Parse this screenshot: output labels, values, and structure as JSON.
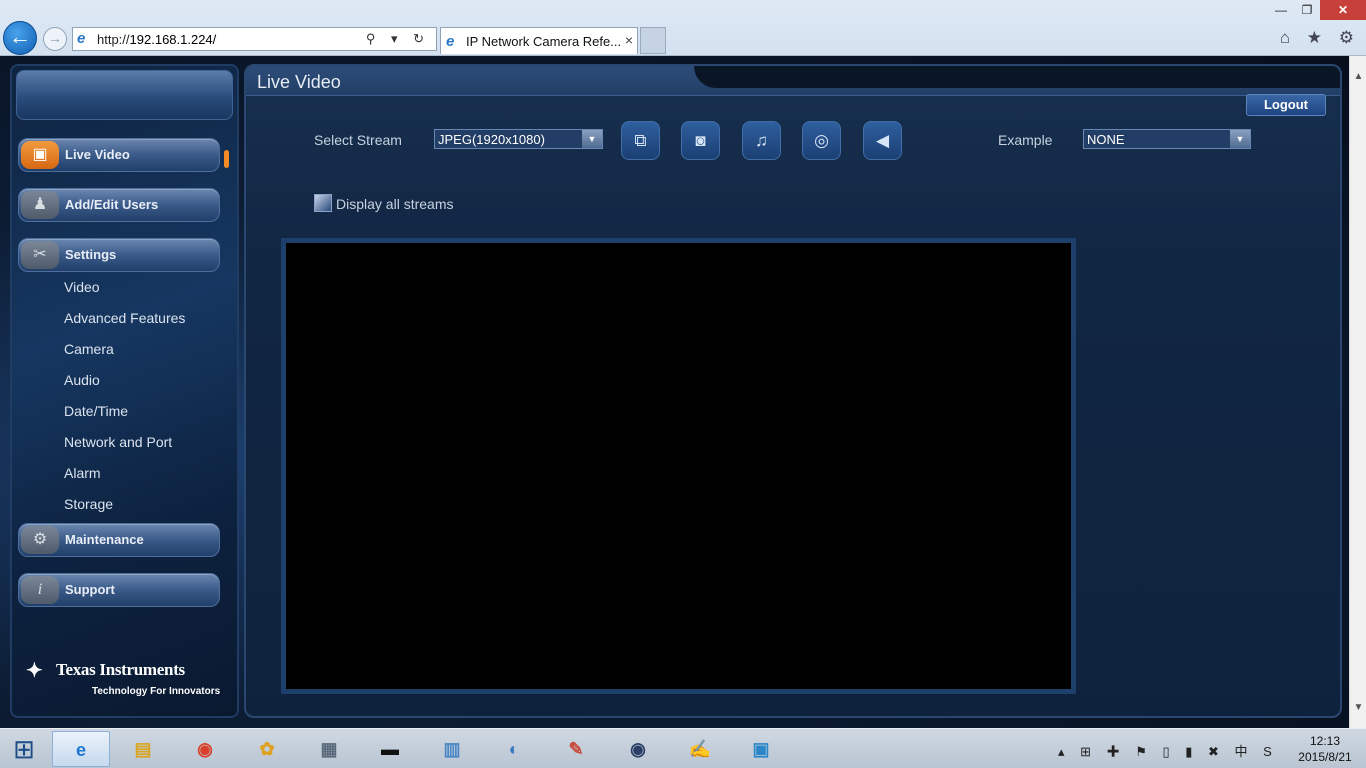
{
  "browser": {
    "address_scheme": "http://",
    "address_host": "192.168.1.224/",
    "tab_title": "IP Network Camera Refe...",
    "tab_close": "×",
    "back_glyph": "←",
    "forward_glyph": "→",
    "address_tools": "⚲ ▾ ↻",
    "right_tools": "⌂ ★ ⚙",
    "window_min": "—",
    "window_restore": "❐",
    "window_close": "✕"
  },
  "sidebar": {
    "nav": [
      {
        "label": "Live Video",
        "icon": "video-camera-icon",
        "glyph": "▣",
        "active": true
      },
      {
        "label": "Add/Edit Users",
        "icon": "add-user-icon",
        "glyph": "♟",
        "active": false
      },
      {
        "label": "Settings",
        "icon": "tools-icon",
        "glyph": "✂",
        "active": false
      },
      {
        "label": "Maintenance",
        "icon": "wrench-gear-icon",
        "glyph": "⚙",
        "active": false
      },
      {
        "label": "Support",
        "icon": "info-icon",
        "glyph": "i",
        "active": false
      }
    ],
    "settings_items": [
      "Video",
      "Advanced Features",
      "Camera",
      "Audio",
      "Date/Time",
      "Network and Port",
      "Alarm",
      "Storage"
    ],
    "logo": {
      "name": "Texas Instruments",
      "tagline": "Technology For Innovators"
    }
  },
  "main": {
    "title": "Live Video",
    "logout_label": "Logout",
    "select_stream_label": "Select Stream",
    "stream_value": "JPEG(1920x1080)",
    "example_label": "Example",
    "example_value": "NONE",
    "display_all_label": "Display all streams",
    "select_arrow": "▼",
    "icon_buttons": [
      {
        "name": "fullscreen-icon",
        "glyph": "⧉"
      },
      {
        "name": "snapshot-camera-icon",
        "glyph": "◙"
      },
      {
        "name": "alarm-bell-icon",
        "glyph": "♫"
      },
      {
        "name": "record-disc-icon",
        "glyph": "◎"
      },
      {
        "name": "speaker-icon",
        "glyph": "◀"
      }
    ]
  },
  "taskbar": {
    "start_glyph": "⊞",
    "apps": [
      {
        "name": "internet-explorer-icon",
        "glyph": "e",
        "color": "#1f78d1",
        "active": true
      },
      {
        "name": "file-explorer-icon",
        "glyph": "▤",
        "color": "#d9a520",
        "active": false
      },
      {
        "name": "chrome-icon",
        "glyph": "◉",
        "color": "#d9402b",
        "active": false
      },
      {
        "name": "paint-palette-icon",
        "glyph": "✿",
        "color": "#e0a020",
        "active": false
      },
      {
        "name": "control-panel-icon",
        "glyph": "▦",
        "color": "#5a6a7a",
        "active": false
      },
      {
        "name": "command-prompt-icon",
        "glyph": "▬",
        "color": "#111111",
        "active": false
      },
      {
        "name": "calculator-icon",
        "glyph": "▥",
        "color": "#4a86c5",
        "active": false
      },
      {
        "name": "network-tool-icon",
        "glyph": "◐",
        "color": "#3d7cc2",
        "active": false
      },
      {
        "name": "paint-icon",
        "glyph": "✎",
        "color": "#c84a3a",
        "active": false
      },
      {
        "name": "media-player-icon",
        "glyph": "◉",
        "color": "#2b3f66",
        "active": false
      },
      {
        "name": "notepad-icon",
        "glyph": "✍",
        "color": "#3c9a3c",
        "active": false
      },
      {
        "name": "virtual-machine-icon",
        "glyph": "▣",
        "color": "#2a86c8",
        "active": false
      }
    ],
    "tray_glyphs": "▴ ⊞ ✚ ⚑ ▯ ▮ ✖ 中 S",
    "time": "12:13",
    "date": "2015/8/21"
  },
  "colors": {
    "accent_orange": "#f28a26",
    "panel_blue": "#112643",
    "button_blue": "#1e4480"
  }
}
